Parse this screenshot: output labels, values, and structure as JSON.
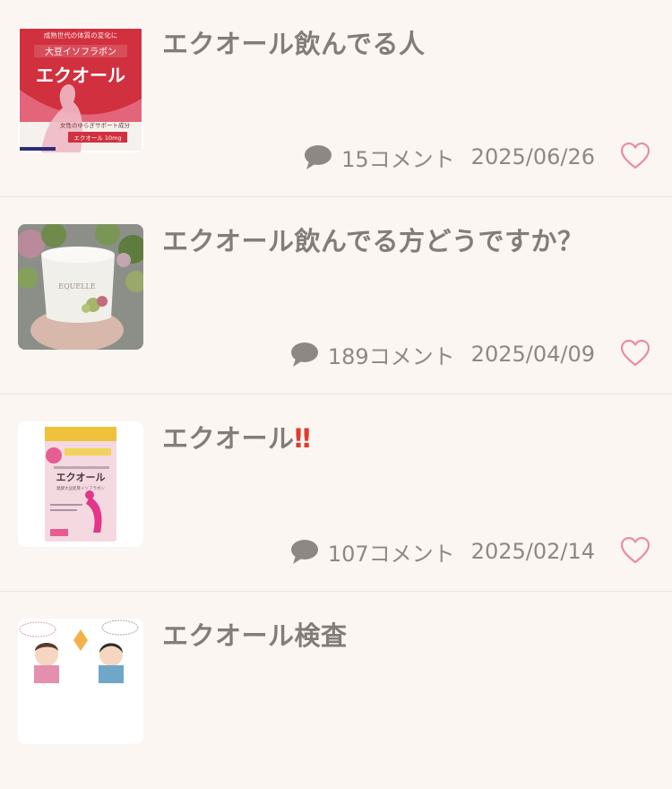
{
  "posts": [
    {
      "title": "エクオール飲んでる人",
      "comments": "15コメント",
      "date": "2025/06/26",
      "thumb": {
        "header": "成熟世代の体質の変化に",
        "subtitle": "大豆イソフラボン",
        "name": "エクオール",
        "support": "女性のゆらぎサポート成分",
        "amount": "エクオール 10mg"
      }
    },
    {
      "title": "エクオール飲んでる方どうですか？",
      "comments": "189コメント",
      "date": "2025/04/09",
      "thumb": {
        "label": "EQUELLE"
      }
    },
    {
      "title": "エクオール",
      "title_suffix": "‼",
      "comments": "107コメント",
      "date": "2025/02/14",
      "thumb": {
        "name": "エクオール",
        "sub": "発酵大豆胚芽イソフラボン"
      }
    },
    {
      "title": "エクオール検査"
    }
  ],
  "colors": {
    "background": "#fbf6f1",
    "title": "#827d78",
    "meta": "#8d8883",
    "heart": "#e88da6",
    "divider": "#ebe4dd"
  }
}
